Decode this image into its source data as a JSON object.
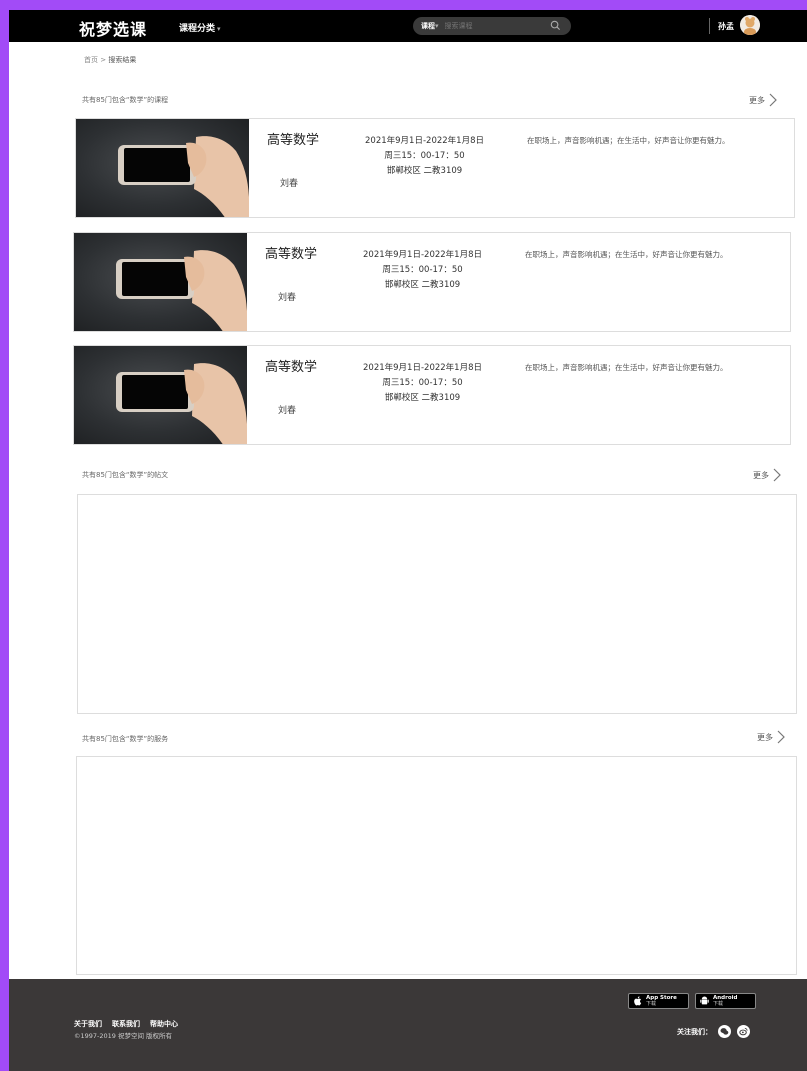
{
  "header": {
    "logo": "祝梦选课",
    "category_label": "课程分类",
    "search": {
      "type_label": "课程",
      "placeholder": "搜索课程"
    },
    "username": "孙孟"
  },
  "breadcrumb": {
    "home": "首页",
    "separator": ">",
    "current": "搜索结果"
  },
  "sections": {
    "courses": {
      "heading": "共有85门包含“数学”的课程",
      "more": "更多"
    },
    "papers": {
      "heading": "共有85门包含“数学”的帖文",
      "more": "更多"
    },
    "services": {
      "heading": "共有85门包含“数学”的服务",
      "more": "更多"
    }
  },
  "courses": [
    {
      "title": "高等数学",
      "teacher": "刘春",
      "dates": "2021年9月1日-2022年1月8日",
      "time": "周三15：00-17：50",
      "location": "邯郸校区 二教3109",
      "description": "在职场上，声音影响机遇；在生活中，好声音让你更有魅力。"
    },
    {
      "title": "高等数学",
      "teacher": "刘春",
      "dates": "2021年9月1日-2022年1月8日",
      "time": "周三15：00-17：50",
      "location": "邯郸校区 二教3109",
      "description": "在职场上，声音影响机遇；在生活中，好声音让你更有魅力。"
    },
    {
      "title": "高等数学",
      "teacher": "刘春",
      "dates": "2021年9月1日-2022年1月8日",
      "time": "周三15：00-17：50",
      "location": "邯郸校区 二教3109",
      "description": "在职场上，声音影响机遇；在生活中，好声音让你更有魅力。"
    }
  ],
  "footer": {
    "links": [
      "关于我们",
      "联系我们",
      "帮助中心"
    ],
    "copyright": "©1997-2019 祝梦空间 版权所有",
    "appstore": {
      "line1": "App Store",
      "line2": "下载"
    },
    "android": {
      "line1": "Android",
      "line2": "下载"
    },
    "follow_label": "关注我们："
  },
  "colors": {
    "page_bg": "#a24bf7",
    "topbar": "#000000",
    "footer": "#3b3838"
  }
}
